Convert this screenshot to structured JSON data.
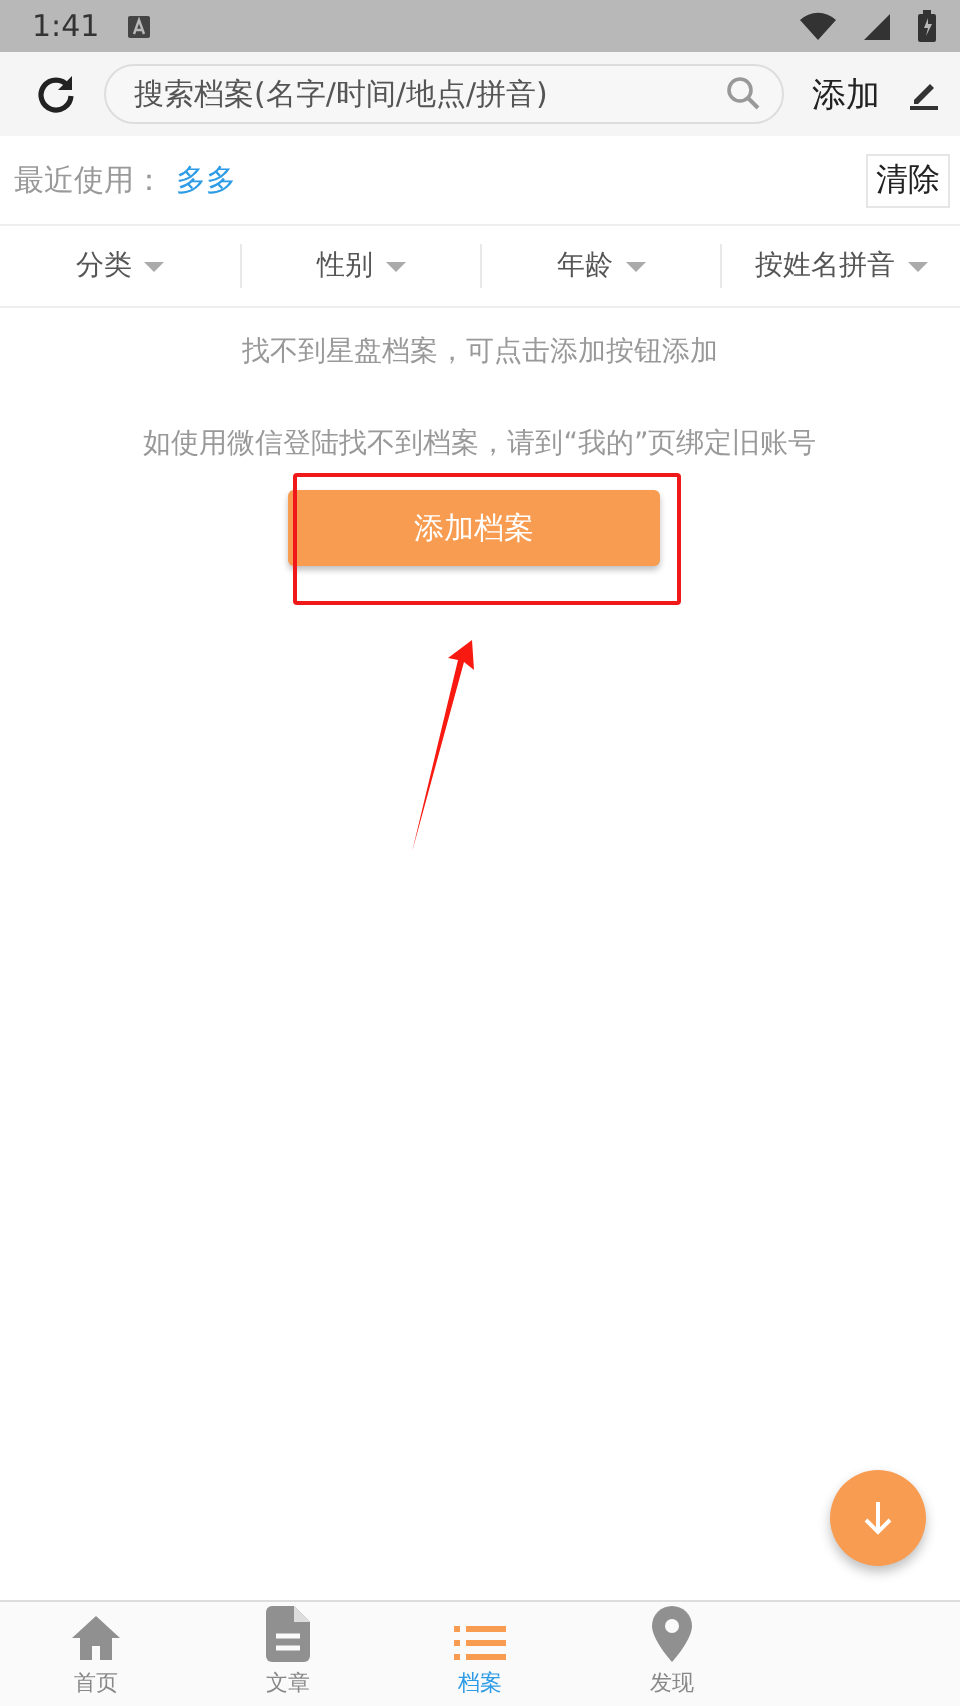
{
  "status_bar": {
    "time": "1:41"
  },
  "toolbar": {
    "search": {
      "placeholder": "搜索档案(名字/时间/地点/拼音)"
    },
    "add_label": "添加"
  },
  "recent": {
    "label": "最近使用：",
    "items": [
      "多多"
    ],
    "clear": "清除"
  },
  "filters": [
    {
      "label": "分类"
    },
    {
      "label": "性别"
    },
    {
      "label": "年龄"
    },
    {
      "label": "按姓名拼音"
    }
  ],
  "messages": [
    "找不到星盘档案，可点击添加按钮添加",
    "如使用微信登陆找不到档案，请到“我的”页绑定旧账号"
  ],
  "add_button": {
    "label": "添加档案",
    "highlighted": true
  },
  "nav": [
    {
      "label": "首页",
      "kind": "home",
      "selected": false
    },
    {
      "label": "文章",
      "kind": "doc",
      "selected": false
    },
    {
      "label": "档案",
      "kind": "list",
      "selected": true
    },
    {
      "label": "发现",
      "kind": "pin",
      "selected": false
    }
  ]
}
